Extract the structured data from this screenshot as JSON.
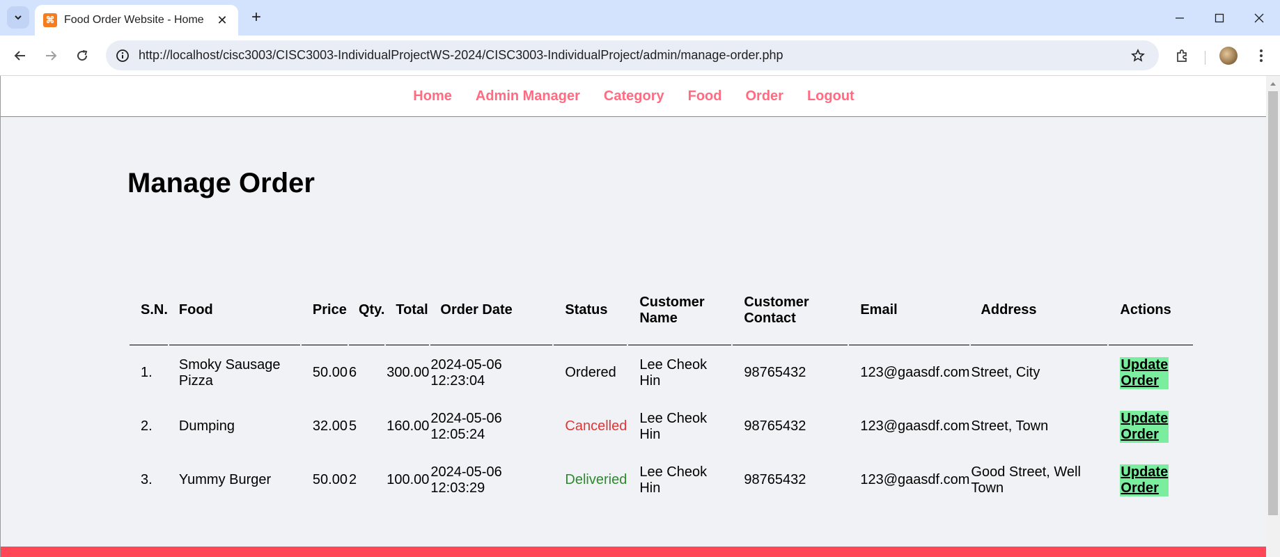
{
  "browser": {
    "tab_title": "Food Order Website - Home Page",
    "new_tab_symbol": "+",
    "url": "http://localhost/cisc3003/CISC3003-IndividualProjectWS-2024/CISC3003-IndividualProject/admin/manage-order.php",
    "icons": [
      "tab-search-icon",
      "close-icon",
      "plus-icon",
      "minimize-icon",
      "maximize-icon",
      "close-window-icon",
      "back-icon",
      "forward-icon",
      "reload-icon",
      "site-info-icon",
      "star-icon",
      "extensions-icon",
      "profile-avatar",
      "more-icon"
    ]
  },
  "nav": {
    "home": "Home",
    "admin_manager": "Admin Manager",
    "category": "Category",
    "food": "Food",
    "order": "Order",
    "logout": "Logout"
  },
  "page": {
    "title": "Manage Order"
  },
  "table": {
    "headers": {
      "sn": "S.N.",
      "food": "Food",
      "price": "Price",
      "qty": "Qty.",
      "total": "Total",
      "order_date": "Order Date",
      "status": "Status",
      "customer_name_1": "Customer",
      "customer_name_2": "Name",
      "customer_contact_1": "Customer",
      "customer_contact_2": "Contact",
      "email": "Email",
      "address": "Address",
      "actions": "Actions"
    },
    "rows": [
      {
        "sn": "1.",
        "food_1": "Smoky Sausage",
        "food_2": "Pizza",
        "price": "50.00",
        "qty": "6",
        "total": "300.00",
        "date_1": "2024-05-06",
        "date_2": "12:23:04",
        "status": "Ordered",
        "name_1": "Lee Cheok",
        "name_2": "Hin",
        "contact": "98765432",
        "email": "123@gaasdf.com",
        "address_1": "Street, City",
        "address_2": "",
        "action_1": "Update",
        "action_2": "Order"
      },
      {
        "sn": "2.",
        "food_1": "Dumping",
        "food_2": "",
        "price": "32.00",
        "qty": "5",
        "total": "160.00",
        "date_1": "2024-05-06",
        "date_2": "12:05:24",
        "status": "Cancelled",
        "name_1": "Lee Cheok",
        "name_2": "Hin",
        "contact": "98765432",
        "email": "123@gaasdf.com",
        "address_1": "Street, Town",
        "address_2": "",
        "action_1": "Update",
        "action_2": "Order"
      },
      {
        "sn": "3.",
        "food_1": "Yummy Burger",
        "food_2": "",
        "price": "50.00",
        "qty": "2",
        "total": "100.00",
        "date_1": "2024-05-06",
        "date_2": "12:03:29",
        "status": "Deliveried",
        "name_1": "Lee Cheok",
        "name_2": "Hin",
        "contact": "98765432",
        "email": "123@gaasdf.com",
        "address_1": "Good Street, Well",
        "address_2": "Town",
        "action_1": "Update",
        "action_2": "Order"
      }
    ]
  },
  "colors": {
    "nav_link": "#ff6b81",
    "update_button": "#7bed9f",
    "status_cancelled": "#e23535",
    "status_delivered": "#2c8a2c",
    "footer_bar": "#ff4757",
    "page_background": "#f1f2f6"
  }
}
